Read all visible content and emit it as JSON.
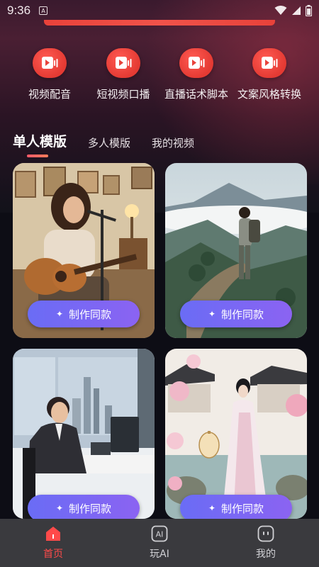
{
  "status": {
    "time": "9:36",
    "a_glyph": "A"
  },
  "quick_actions": [
    {
      "label": "视频配音",
      "icon": "video-dub-icon"
    },
    {
      "label": "短视频口播",
      "icon": "video-dub-icon"
    },
    {
      "label": "直播话术脚本",
      "icon": "video-dub-icon"
    },
    {
      "label": "文案风格转换",
      "icon": "video-dub-icon"
    }
  ],
  "tabs": [
    {
      "label": "单人模版",
      "active": true
    },
    {
      "label": "多人模版",
      "active": false
    },
    {
      "label": "我的视频",
      "active": false
    }
  ],
  "cards": [
    {
      "scene": "guitar-singer",
      "button": "制作同款"
    },
    {
      "scene": "mountain-hiker",
      "button": "制作同款"
    },
    {
      "scene": "office-man",
      "button": "制作同款"
    },
    {
      "scene": "hanfu-lady",
      "button": "制作同款"
    }
  ],
  "bottom_nav": [
    {
      "label": "首页",
      "icon": "home-icon",
      "active": true
    },
    {
      "label": "玩AI",
      "icon": "ai-icon",
      "active": false
    },
    {
      "label": "我的",
      "icon": "profile-icon",
      "active": false
    }
  ],
  "colors": {
    "accent": "#ff4a4a",
    "button": "#7568f3",
    "quick_icon": "#e8423a"
  }
}
